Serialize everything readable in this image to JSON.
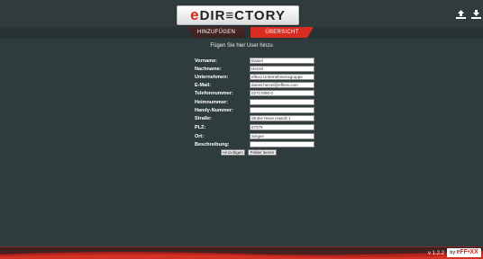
{
  "app": {
    "logo_e": "e",
    "logo_rest": "DIR≡CTORY",
    "upload_icon": "upload-icon",
    "download_icon": "download-icon"
  },
  "tabs": [
    {
      "label": "HINZUFÜGEN",
      "active": false
    },
    {
      "label": "ÜBERSICHT",
      "active": true
    }
  ],
  "form": {
    "title": "Fügen Sie hier User hinzu",
    "fields": [
      {
        "label": "Vorname:",
        "value": "Daniel"
      },
      {
        "label": "Nachname:",
        "value": "Herzel"
      },
      {
        "label": "Unternehmen:",
        "value": "effexx Unternehmensgruppe"
      },
      {
        "label": "E-Mail:",
        "value": "daniel.herzel@effexx.com"
      },
      {
        "label": "Telefonnummer:",
        "value": "02717090-0"
      },
      {
        "label": "Heimnummer:",
        "value": ""
      },
      {
        "label": "Handy-Nummer:",
        "value": ""
      },
      {
        "label": "Straße:",
        "value": "Struke Neue Haardt 1"
      },
      {
        "label": "PLZ:",
        "value": "57076"
      },
      {
        "label": "Ort:",
        "value": "Siegen"
      },
      {
        "label": "Beschreibung:",
        "value": ""
      }
    ],
    "add_button": "Hinzufügen",
    "clear_button": "Felder leeren"
  },
  "footer": {
    "version": "v 1.2.2",
    "brand_by": "by ",
    "brand_name": "eFF•XX"
  },
  "colors": {
    "background": "#2e3c3e",
    "accent_red": "#d72c21"
  }
}
